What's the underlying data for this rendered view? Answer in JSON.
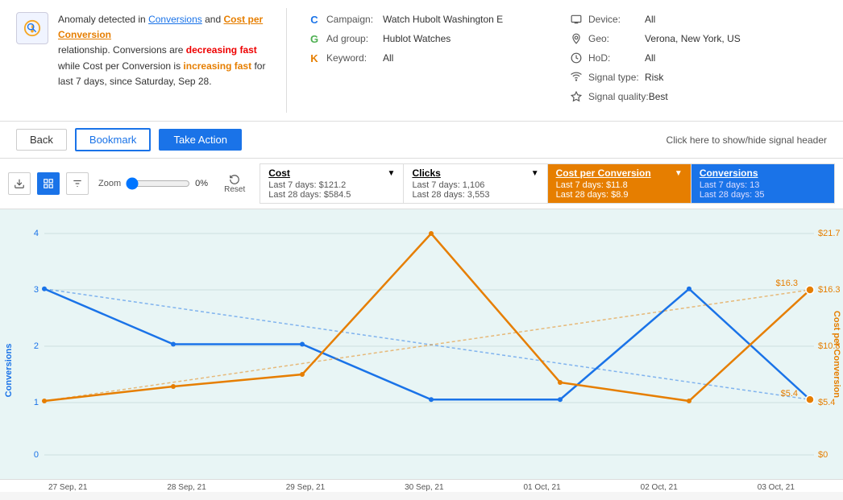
{
  "anomaly": {
    "text_prefix": "Anomaly detected in ",
    "conversions_link": "Conversions",
    "text_mid": " and ",
    "cost_link": "Cost per Conversion",
    "text_post": " relationship. Conversions are ",
    "decreasing": "decreasing fast",
    "text2": " while Cost per Conversion is ",
    "increasing": "increasing fast",
    "text3": " for last 7 days, since Saturday, Sep 28."
  },
  "campaign": {
    "label": "Campaign:",
    "value": "Watch Hubolt Washington E"
  },
  "adgroup": {
    "label": "Ad group:",
    "value": "Hublot Watches"
  },
  "keyword": {
    "label": "Keyword:",
    "value": "All"
  },
  "device": {
    "label": "Device:",
    "value": "All"
  },
  "geo": {
    "label": "Geo:",
    "value": "Verona, New York, US"
  },
  "hod": {
    "label": "HoD:",
    "value": "All"
  },
  "signal_type": {
    "label": "Signal type:",
    "value": "Risk"
  },
  "signal_quality": {
    "label": "Signal quality:",
    "value": "Best"
  },
  "actions": {
    "back": "Back",
    "bookmark": "Bookmark",
    "take_action": "Take Action",
    "hint": "Click here to show/hide signal header"
  },
  "toolbar": {
    "zoom_label": "Zoom",
    "zoom_value": "0%",
    "reset_label": "Reset"
  },
  "metrics": {
    "cost": {
      "label": "Cost",
      "last7": "Last 7 days: $121.2",
      "last28": "Last 28 days: $584.5"
    },
    "clicks": {
      "label": "Clicks",
      "last7": "Last 7 days: 1,106",
      "last28": "Last 28 days: 3,553"
    },
    "cost_per_conversion": {
      "label": "Cost per Conversion",
      "last7": "Last 7 days: $11.8",
      "last28": "Last 28 days: $8.9"
    },
    "conversions": {
      "label": "Conversions",
      "last7": "Last 7 days: 13",
      "last28": "Last 28 days: 35"
    }
  },
  "x_axis": {
    "labels": [
      "27 Sep, 21",
      "28 Sep, 21",
      "29 Sep, 21",
      "30 Sep, 21",
      "01 Oct, 21",
      "02 Oct, 21",
      "03 Oct, 21"
    ]
  },
  "y_left": {
    "labels": [
      "4",
      "3",
      "2",
      "1",
      "0"
    ],
    "axis_label": "Conversions"
  },
  "y_right": {
    "labels": [
      "$21.7",
      "$16.3",
      "$10.8",
      "$5.4",
      "$0"
    ],
    "axis_label": "Cost per Conversion"
  },
  "dot_labels": {
    "right_top": "$16.3",
    "right_bottom": "$5.4"
  }
}
